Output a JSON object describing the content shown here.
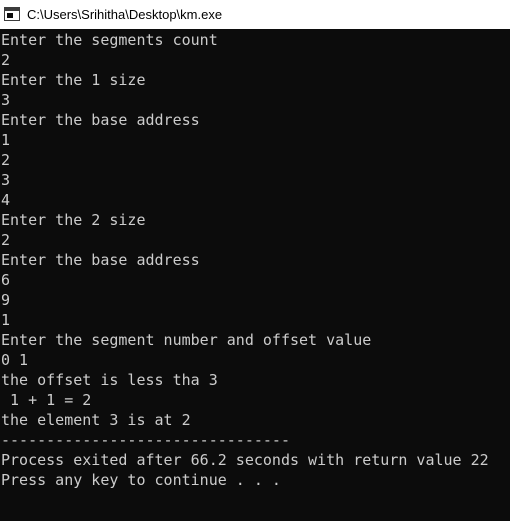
{
  "window": {
    "title": "C:\\Users\\Srihitha\\Desktop\\km.exe",
    "icon": "console-app-icon"
  },
  "colors": {
    "console_background": "#0c0c0c",
    "console_text": "#cccccc",
    "titlebar_background": "#ffffff"
  },
  "console": {
    "lines": [
      "Enter the segments count",
      "2",
      "Enter the 1 size",
      "3",
      "Enter the base address",
      "1",
      "2",
      "3",
      "4",
      "Enter the 2 size",
      "2",
      "Enter the base address",
      "6",
      "9",
      "1",
      "Enter the segment number and offset value",
      "0 1",
      "the offset is less tha 3",
      " 1 + 1 = 2",
      "the element 3 is at 2",
      "--------------------------------",
      "Process exited after 66.2 seconds with return value 22",
      "Press any key to continue . . ."
    ]
  }
}
